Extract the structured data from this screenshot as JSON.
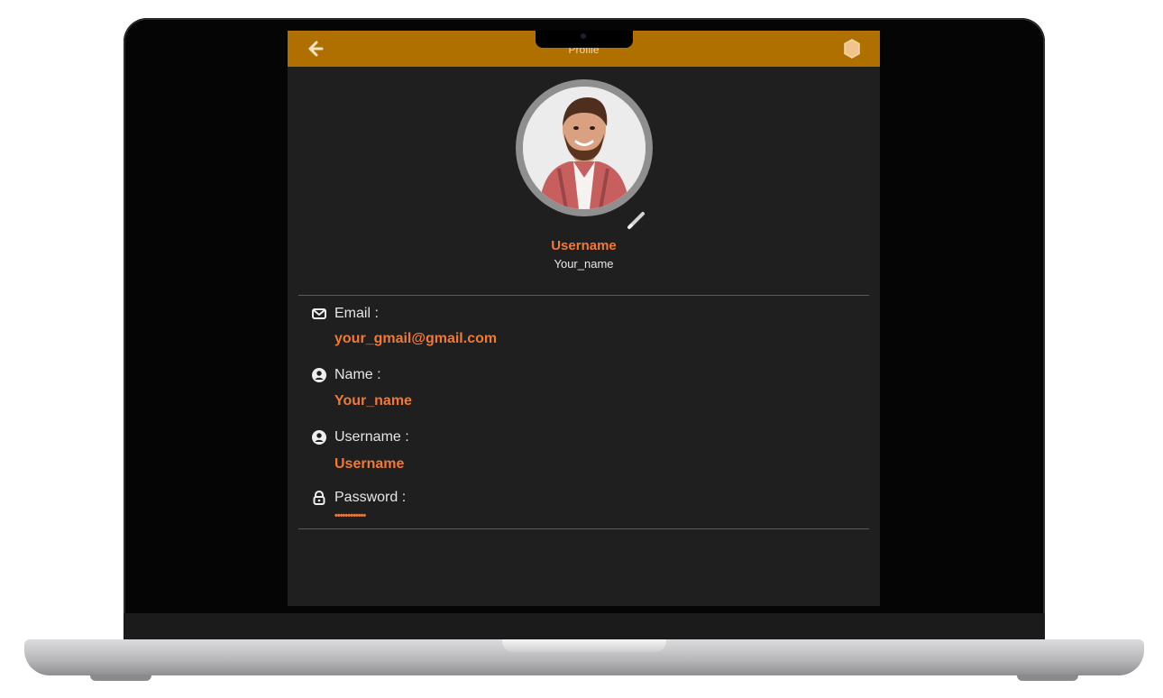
{
  "appbar": {
    "title": "Profile",
    "back_icon": "arrow-left-icon",
    "settings_icon": "hexagon-settings-icon",
    "color": "#b07000"
  },
  "profile": {
    "avatar_icon": "profile-photo",
    "edit_icon": "pencil-icon",
    "username_title": "Username",
    "username_sub": "Your_name"
  },
  "fields": [
    {
      "label": "Email :",
      "value": "your_gmail@gmail.com",
      "icon": "envelope-icon"
    },
    {
      "label": "Name :",
      "value": "Your_name",
      "icon": "user-circle-icon"
    },
    {
      "label": "Username :",
      "value": "Username",
      "icon": "user-circle-icon"
    },
    {
      "label": "Password :",
      "value": "••••••••••••",
      "icon": "lock-icon"
    }
  ],
  "theme": {
    "accent": "#ef7a36",
    "background": "#1f1f1f",
    "text": "#e6e6e6"
  }
}
